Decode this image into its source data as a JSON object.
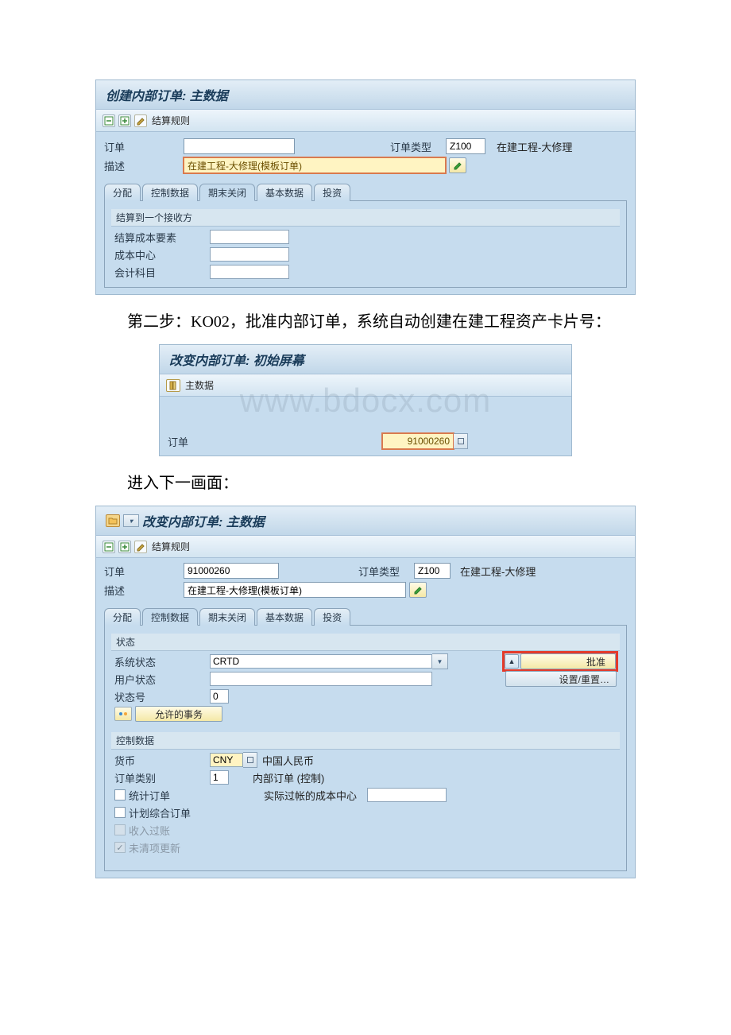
{
  "panel1": {
    "title": "创建内部订单: 主数据",
    "toolbar": {
      "settlement": "结算规则"
    },
    "order_label": "订单",
    "order_value": "",
    "order_type_label": "订单类型",
    "order_type_value": "Z100",
    "order_type_text": "在建工程-大修理",
    "desc_label": "描述",
    "desc_value": "在建工程-大修理(模板订单)",
    "tabs": [
      "分配",
      "控制数据",
      "期末关闭",
      "基本数据",
      "投资"
    ],
    "group_title": "结算到一个接收方",
    "rows": {
      "cost_elem": "结算成本要素",
      "cost_center": "成本中心",
      "gl_account": "会计科目"
    }
  },
  "narr1": "第二步：KO02，批准内部订单，系统自动创建在建工程资产卡片号：",
  "panel2": {
    "title": "改变内部订单: 初始屏幕",
    "toolbar": {
      "master": "主数据"
    },
    "order_label": "订单",
    "order_value": "91000260"
  },
  "watermark": "www.bdocx.com",
  "narr2": "进入下一画面：",
  "panel3": {
    "title": "改变内部订单: 主数据",
    "toolbar": {
      "settlement": "结算规则"
    },
    "order_label": "订单",
    "order_value": "91000260",
    "order_type_label": "订单类型",
    "order_type_value": "Z100",
    "order_type_text": "在建工程-大修理",
    "desc_label": "描述",
    "desc_value": "在建工程-大修理(模板订单)",
    "tabs": [
      "分配",
      "控制数据",
      "期末关闭",
      "基本数据",
      "投资"
    ],
    "status": {
      "header": "状态",
      "sys_label": "系统状态",
      "sys_value": "CRTD",
      "approve_btn": "批准",
      "setreset_btn": "设置/重置…",
      "usr_label": "用户状态",
      "num_label": "状态号",
      "num_value": "0",
      "allowed_btn": "允许的事务"
    },
    "control": {
      "header": "控制数据",
      "cur_label": "货币",
      "cur_value": "CNY",
      "cur_text": "中国人民币",
      "cat_label": "订单类别",
      "cat_value": "1",
      "cat_text": "内部订单 (控制)",
      "act_cc_label": "实际过帐的成本中心",
      "chk_stat": "统计订单",
      "chk_plan": "计划综合订单",
      "chk_rev": "收入过账",
      "chk_open": "未清项更新"
    }
  }
}
